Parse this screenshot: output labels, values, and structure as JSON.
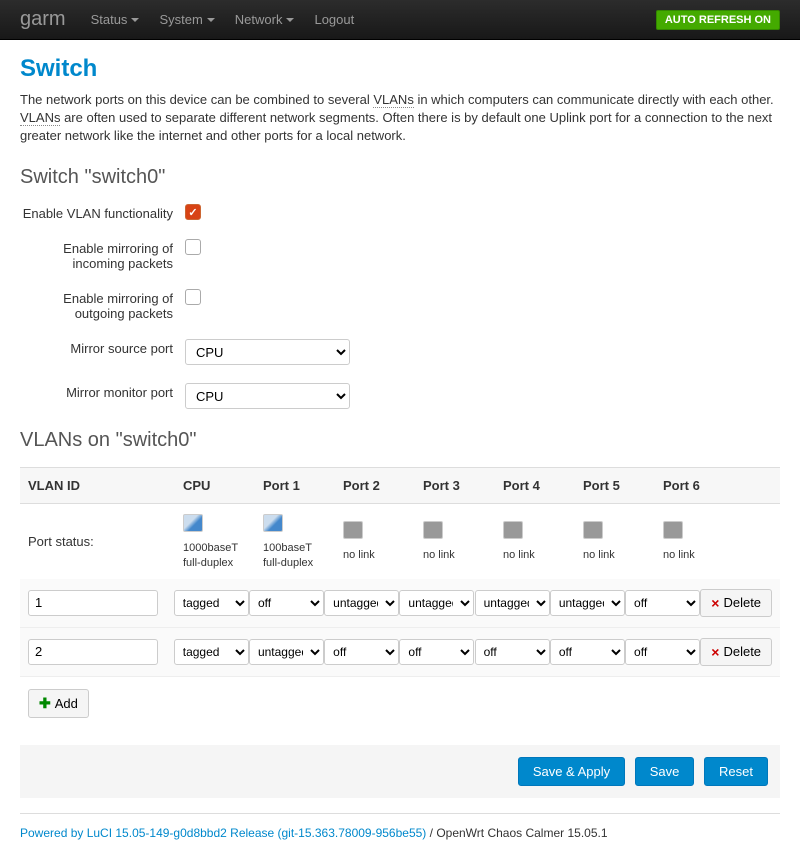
{
  "navbar": {
    "brand": "garm",
    "items": [
      "Status",
      "System",
      "Network",
      "Logout"
    ],
    "refresh_badge": "AUTO REFRESH ON"
  },
  "page": {
    "title": "Switch",
    "description_pre": "The network ports on this device can be combined to several ",
    "description_abbr1": "VLANs",
    "description_mid": " in which computers can communicate directly with each other. ",
    "description_abbr2": "VLANs",
    "description_post": " are often used to separate different network segments. Often there is by default one Uplink port for a connection to the next greater network like the internet and other ports for a local network."
  },
  "switch": {
    "heading": "Switch \"switch0\"",
    "labels": {
      "enable_vlan": "Enable VLAN functionality",
      "mirror_rx": "Enable mirroring of incoming packets",
      "mirror_tx": "Enable mirroring of outgoing packets",
      "mirror_src": "Mirror source port",
      "mirror_mon": "Mirror monitor port"
    },
    "values": {
      "enable_vlan": true,
      "mirror_rx": false,
      "mirror_tx": false,
      "mirror_src": "CPU",
      "mirror_mon": "CPU"
    }
  },
  "vlans": {
    "heading": "VLANs on \"switch0\"",
    "headers": [
      "VLAN ID",
      "CPU",
      "Port 1",
      "Port 2",
      "Port 3",
      "Port 4",
      "Port 5",
      "Port 6"
    ],
    "status_label": "Port status:",
    "port_status": [
      {
        "link": true,
        "text1": "1000baseT",
        "text2": "full-duplex"
      },
      {
        "link": true,
        "text1": "100baseT",
        "text2": "full-duplex"
      },
      {
        "link": false,
        "text1": "no link",
        "text2": ""
      },
      {
        "link": false,
        "text1": "no link",
        "text2": ""
      },
      {
        "link": false,
        "text1": "no link",
        "text2": ""
      },
      {
        "link": false,
        "text1": "no link",
        "text2": ""
      },
      {
        "link": false,
        "text1": "no link",
        "text2": ""
      }
    ],
    "rows": [
      {
        "id": "1",
        "ports": [
          "tagged",
          "off",
          "untagged",
          "untagged",
          "untagged",
          "untagged",
          "off"
        ]
      },
      {
        "id": "2",
        "ports": [
          "tagged",
          "untagged",
          "off",
          "off",
          "off",
          "off",
          "off"
        ]
      }
    ],
    "delete_label": "Delete",
    "add_label": "Add"
  },
  "buttons": {
    "save_apply": "Save & Apply",
    "save": "Save",
    "reset": "Reset"
  },
  "footer": {
    "link": "Powered by LuCI 15.05-149-g0d8bbd2 Release (git-15.363.78009-956be55)",
    "tail": "OpenWrt Chaos Calmer 15.05.1"
  }
}
